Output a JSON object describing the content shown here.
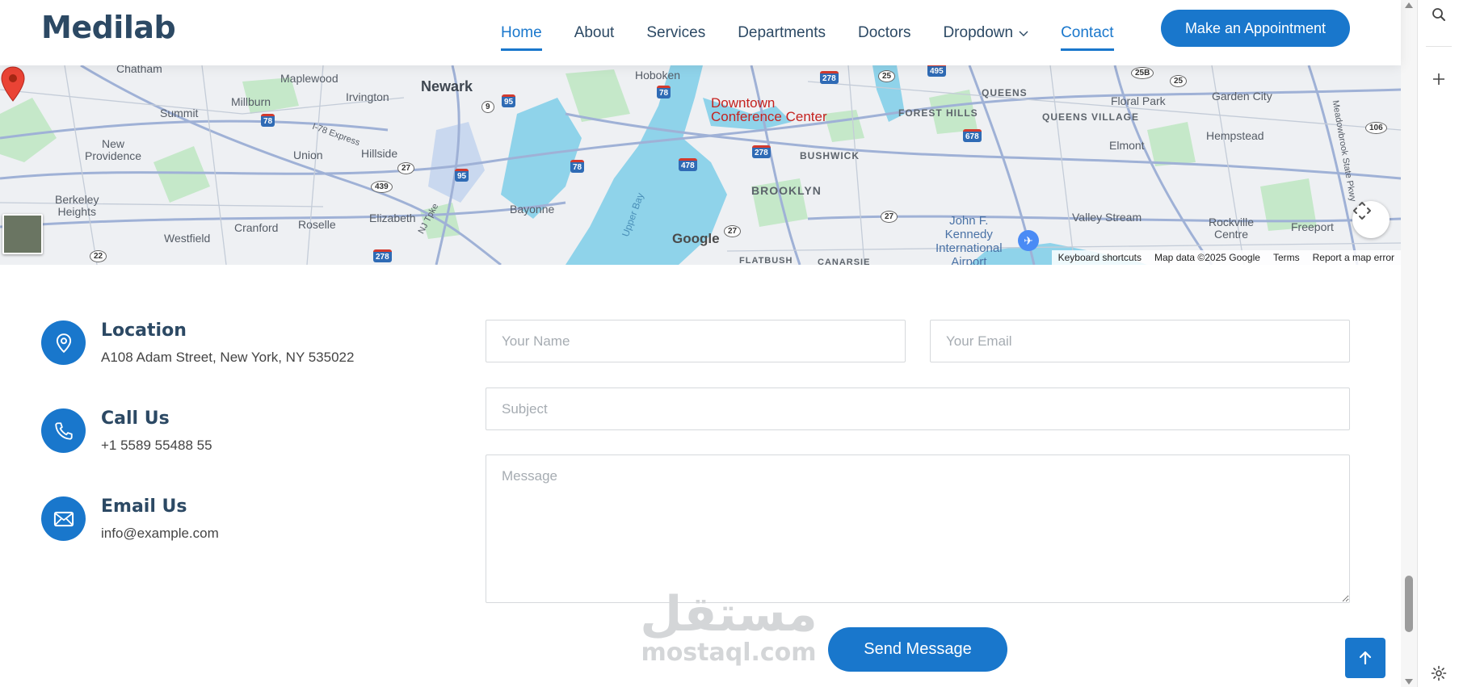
{
  "header": {
    "logo": "Medilab",
    "nav": [
      {
        "label": "Home",
        "active": true
      },
      {
        "label": "About",
        "active": false
      },
      {
        "label": "Services",
        "active": false
      },
      {
        "label": "Departments",
        "active": false
      },
      {
        "label": "Doctors",
        "active": false
      },
      {
        "label": "Dropdown",
        "active": false
      },
      {
        "label": "Contact",
        "active": true
      }
    ],
    "appointment_button": "Make an Appointment"
  },
  "map": {
    "pin_label_line1": "Downtown",
    "pin_label_line2": "Conference Center",
    "labels": {
      "chatham": "Chatham",
      "maplewood": "Maplewood",
      "newark": "Newark",
      "hoboken": "Hoboken",
      "queens": "QUEENS",
      "floral_park": "Floral Park",
      "garden_city": "Garden City",
      "summit": "Summit",
      "millburn": "Millburn",
      "irvington": "Irvington",
      "forest_hills": "FOREST HILLS",
      "queens_village": "QUEENS VILLAGE",
      "new_providence": "New\nProvidence",
      "union": "Union",
      "hillside": "Hillside",
      "bushwick": "BUSHWICK",
      "elmont": "Elmont",
      "hempstead": "Hempstead",
      "berkeley_heights": "Berkeley\nHeights",
      "bayonne": "Bayonne",
      "brooklyn": "BROOKLYN",
      "cranford": "Cranford",
      "roselle": "Roselle",
      "elizabeth": "Elizabeth",
      "westfield": "Westfield",
      "valley_stream": "Valley Stream",
      "rockville_centre": "Rockville\nCentre",
      "freeport": "Freeport",
      "jfk": "John F.\nKennedy\nInternational\nAirport",
      "flatbush": "FLATBUSH",
      "canarsie": "CANARSIE",
      "upper_bay": "Upper Bay",
      "nj_tpke": "NJ Tpke",
      "i78_express": "I-78 Express",
      "meadowbrook": "Meadowbrook State Pkwy"
    },
    "shields": [
      "78",
      "95",
      "9",
      "78",
      "278",
      "495",
      "25",
      "25B",
      "25",
      "27",
      "439",
      "95",
      "78",
      "278",
      "678",
      "478",
      "27",
      "22",
      "278",
      "27",
      "106"
    ],
    "google_logo": "Google",
    "footer": [
      "Keyboard shortcuts",
      "Map data ©2025 Google",
      "Terms",
      "Report a map error"
    ],
    "icons": {
      "pin": "map-pin-icon",
      "fullscreen": "fullscreen-icon",
      "airport": "airport-icon",
      "layer": "satellite-layer-thumbnail"
    }
  },
  "contact_info": [
    {
      "title": "Location",
      "text": "A108 Adam Street, New York, NY 535022",
      "icon": "location-pin-icon"
    },
    {
      "title": "Call Us",
      "text": "+1 5589 55488 55",
      "icon": "phone-icon"
    },
    {
      "title": "Email Us",
      "text": "info@example.com",
      "icon": "envelope-icon"
    }
  ],
  "form": {
    "name_placeholder": "Your Name",
    "email_placeholder": "Your Email",
    "subject_placeholder": "Subject",
    "message_placeholder": "Message",
    "send_label": "Send Message"
  },
  "watermark": {
    "arabic": "مستقل",
    "latin": "mostaql.com"
  },
  "colors": {
    "accent": "#1977cc",
    "heading": "#2c4964",
    "text": "#444444",
    "border": "#d6d9dc"
  }
}
